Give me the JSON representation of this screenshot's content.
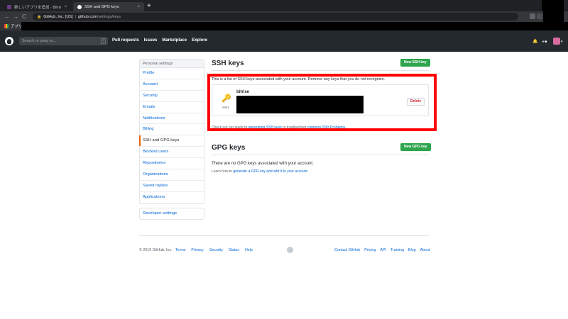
{
  "browser": {
    "tabs": [
      {
        "label": "新しいアプリを追加 · Bitrise",
        "close": "×",
        "favicon_color": "#683d87"
      },
      {
        "label": "SSH and GPG keys",
        "close": "×",
        "favicon_color": "#ffffff"
      }
    ],
    "new_tab": "+",
    "nav": {
      "back": "←",
      "forward": "→",
      "reload": "C"
    },
    "address": {
      "lock": "🔒",
      "site": "GitHub, Inc. [US]",
      "sep": "|",
      "host": "github.com",
      "path": "/settings/keys"
    },
    "bookmark_label": "アプリ"
  },
  "header": {
    "search_placeholder": "Search or jump to...",
    "search_key": "/",
    "nav": [
      "Pull requests",
      "Issues",
      "Marketplace",
      "Explore"
    ],
    "bell": "🔔",
    "plus": "+▾",
    "avatar_caret": "▾"
  },
  "sidebar": {
    "heading": "Personal settings",
    "items": [
      "Profile",
      "Account",
      "Security",
      "Emails",
      "Notifications",
      "Billing",
      "SSH and GPG keys",
      "Blocked users",
      "Repositories",
      "Organizations",
      "Saved replies",
      "Applications"
    ],
    "selected": "SSH and GPG keys",
    "developer": "Developer settings"
  },
  "ssh": {
    "title": "SSH keys",
    "new_button": "New SSH key",
    "intro": "This is a list of SSH keys associated with your account. Remove any keys that you do not recognize.",
    "key": {
      "glyph": "🔑",
      "type": "SSH",
      "name": "bitrise"
    },
    "delete_button": "Delete",
    "guide_prefix": "Check out our guide to",
    "guide_link1": "generating SSH keys",
    "guide_mid": "or troubleshoot",
    "guide_link2": "common SSH Problems",
    "guide_suffix": "."
  },
  "gpg": {
    "title": "GPG keys",
    "new_button": "New GPG key",
    "none": "There are no GPG keys associated with your account.",
    "learn_prefix": "Learn how to",
    "learn_link": "generate a GPG key and add it to your account",
    "learn_suffix": "."
  },
  "footer": {
    "copyright": "© 2019 GitHub, Inc.",
    "left_links": [
      "Terms",
      "Privacy",
      "Security",
      "Status",
      "Help"
    ],
    "right_links": [
      "Contact GitHub",
      "Pricing",
      "API",
      "Training",
      "Blog",
      "About"
    ]
  },
  "colors": {
    "highlight": "#ff0000",
    "accent_green": "#2ea44f",
    "link": "#0366d6",
    "selected_marker": "#e36209"
  }
}
